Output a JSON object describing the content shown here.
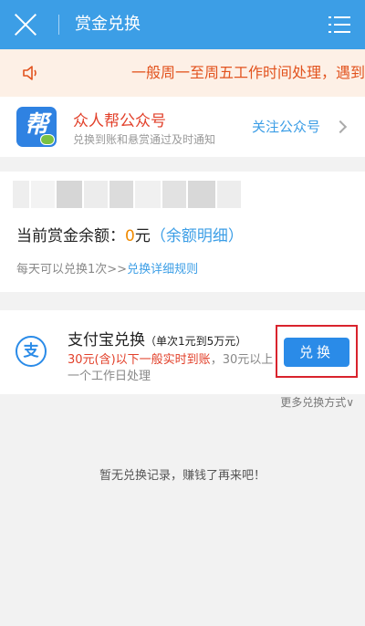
{
  "header": {
    "title": "赏金兑换",
    "close_icon": "close-icon",
    "menu_icon": "list-menu-icon"
  },
  "notice": {
    "icon": "speaker-icon",
    "text": "一般周一至周五工作时间处理，遇到"
  },
  "official_account": {
    "logo_char": "帮",
    "name": "众人帮公众号",
    "description": "兑换到账和悬赏通过及时通知",
    "follow_label": "关注公众号"
  },
  "balance": {
    "label_prefix": "当前赏金余额：",
    "amount": "0",
    "unit": "元",
    "paren_open": "（",
    "detail_link": "余额明细",
    "paren_close": "）",
    "rule_text": "每天可以兑换1次>>",
    "rule_link": "兑换详细规则"
  },
  "alipay": {
    "icon_char": "支",
    "title": "支付宝兑换",
    "limit": "（单次1元到5万元）",
    "note_red": "30元(含)以下一般实时到账",
    "note_gray": "，30元以上",
    "note_line2": "一个工作日处理",
    "button_label": "兑换"
  },
  "more_methods": "更多兑换方式∨",
  "empty_state": "暂无兑换记录，赚钱了再来吧！",
  "colors": {
    "header": "#3c9ee6",
    "notice_bg": "#fdf0e6",
    "accent_red": "#e2402a",
    "amount": "#f08a00",
    "button": "#2a8be8"
  }
}
